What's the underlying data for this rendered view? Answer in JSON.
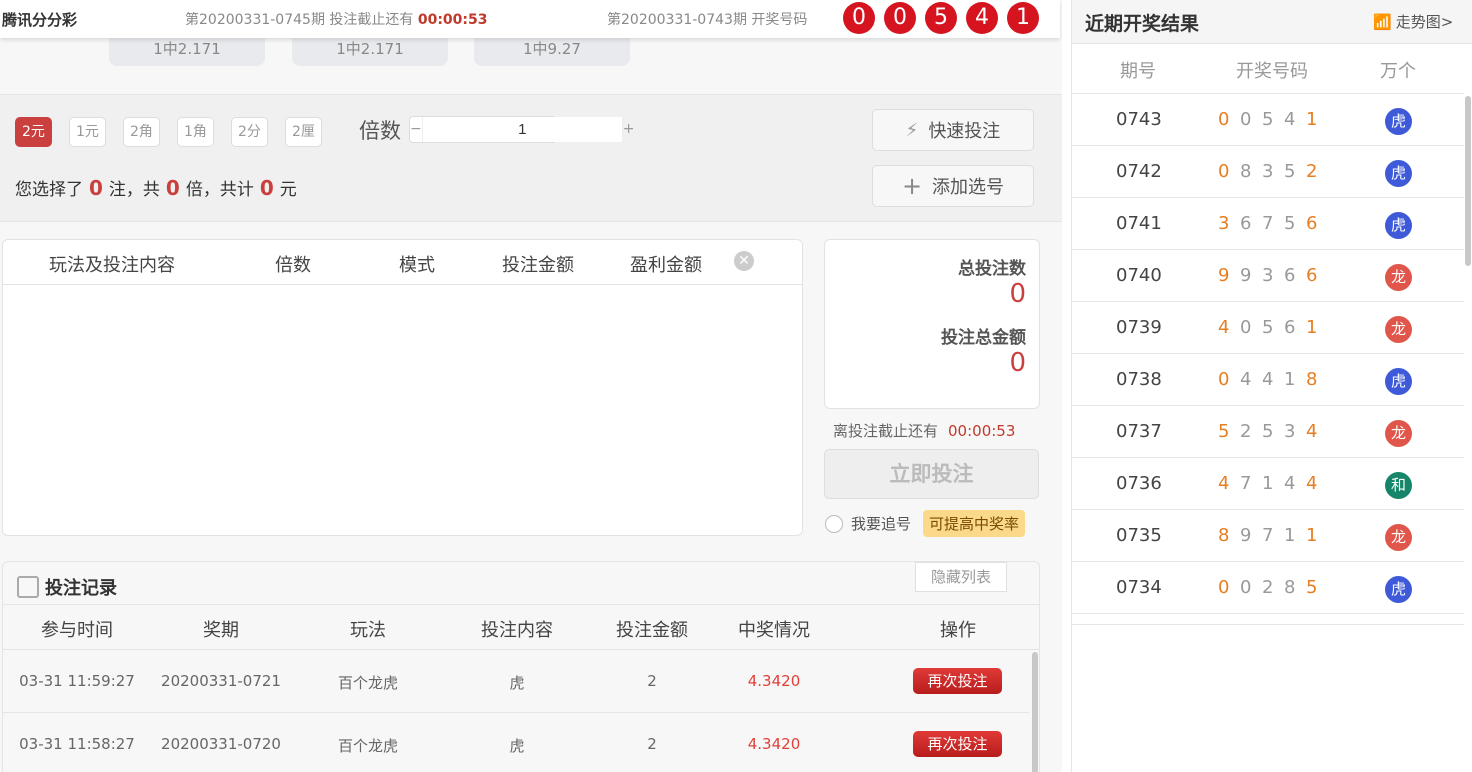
{
  "header": {
    "brand": "腾讯分分彩",
    "current_prefix": "第20200331-0745期 投注截止还有",
    "countdown": "00:00:53",
    "prev_label": "第20200331-0743期 开奖号码",
    "balls": [
      "0",
      "0",
      "5",
      "4",
      "1"
    ]
  },
  "odds": [
    "1中2.171",
    "1中2.171",
    "1中9.27"
  ],
  "modes": [
    "2元",
    "1元",
    "2角",
    "1角",
    "2分",
    "2厘"
  ],
  "multiplier": {
    "label": "倍数",
    "value": "1",
    "minus": "−",
    "plus": "+"
  },
  "quick_bet": "快速投注",
  "add_pick": "添加选号",
  "summary": {
    "p1": "您选择了",
    "count": "0",
    "p2": "注，共",
    "times": "0",
    "p3": "倍，共计",
    "total": "0",
    "p4": "元"
  },
  "cart": {
    "cols": [
      "玩法及投注内容",
      "倍数",
      "模式",
      "投注金额",
      "盈利金额"
    ]
  },
  "totals": {
    "count_label": "总投注数",
    "count": "0",
    "amount_label": "投注总金额",
    "amount": "0"
  },
  "deadline": {
    "label": "离投注截止还有",
    "time": "00:00:53"
  },
  "submit": "立即投注",
  "chase": {
    "label": "我要追号",
    "tip": "可提高中奖率"
  },
  "records": {
    "title": "投注记录",
    "hide": "隐藏列表",
    "cols": [
      "参与时间",
      "奖期",
      "玩法",
      "投注内容",
      "投注金额",
      "中奖情况",
      "操作"
    ],
    "rows": [
      {
        "time": "03-31 11:59:27",
        "issue": "20200331-0721",
        "play": "百个龙虎",
        "content": "虎",
        "amount": "2",
        "win": "4.3420",
        "action": "再次投注"
      },
      {
        "time": "03-31 11:58:27",
        "issue": "20200331-0720",
        "play": "百个龙虎",
        "content": "虎",
        "amount": "2",
        "win": "4.3420",
        "action": "再次投注"
      }
    ]
  },
  "recent": {
    "title": "近期开奖结果",
    "trend": "走势图>",
    "cols": [
      "期号",
      "开奖号码",
      "万个"
    ],
    "colors": {
      "虎": "#3e5ad8",
      "龙": "#e0564b",
      "和": "#17856a"
    },
    "rows": [
      {
        "issue": "0743",
        "digits": [
          "0",
          "0",
          "5",
          "4",
          "1"
        ],
        "result": "虎"
      },
      {
        "issue": "0742",
        "digits": [
          "0",
          "8",
          "3",
          "5",
          "2"
        ],
        "result": "虎"
      },
      {
        "issue": "0741",
        "digits": [
          "3",
          "6",
          "7",
          "5",
          "6"
        ],
        "result": "虎"
      },
      {
        "issue": "0740",
        "digits": [
          "9",
          "9",
          "3",
          "6",
          "6"
        ],
        "result": "龙"
      },
      {
        "issue": "0739",
        "digits": [
          "4",
          "0",
          "5",
          "6",
          "1"
        ],
        "result": "龙"
      },
      {
        "issue": "0738",
        "digits": [
          "0",
          "4",
          "4",
          "1",
          "8"
        ],
        "result": "虎"
      },
      {
        "issue": "0737",
        "digits": [
          "5",
          "2",
          "5",
          "3",
          "4"
        ],
        "result": "龙"
      },
      {
        "issue": "0736",
        "digits": [
          "4",
          "7",
          "1",
          "4",
          "4"
        ],
        "result": "和"
      },
      {
        "issue": "0735",
        "digits": [
          "8",
          "9",
          "7",
          "1",
          "1"
        ],
        "result": "龙"
      },
      {
        "issue": "0734",
        "digits": [
          "0",
          "0",
          "2",
          "8",
          "5"
        ],
        "result": "虎"
      }
    ]
  }
}
